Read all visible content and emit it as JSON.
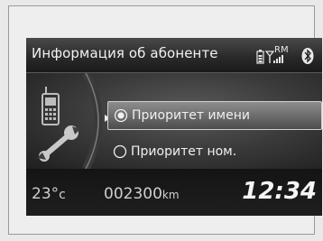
{
  "header": {
    "title": "Информация об абоненте",
    "icons": [
      "phone-battery-icon",
      "signal-strength-icon",
      "roaming-indicator",
      "bluetooth-icon"
    ],
    "roaming_label": "RM"
  },
  "menu": {
    "side_icons": [
      "mobile-phone-icon",
      "wrench-icon"
    ],
    "options": [
      {
        "label": "Приоритет имени",
        "selected": true
      },
      {
        "label": "Приоритет ном.",
        "selected": false
      }
    ]
  },
  "footer": {
    "temperature_value": "23°",
    "temperature_unit": "c",
    "odometer_value": "002300",
    "odometer_unit": "km",
    "clock": "12:34"
  }
}
